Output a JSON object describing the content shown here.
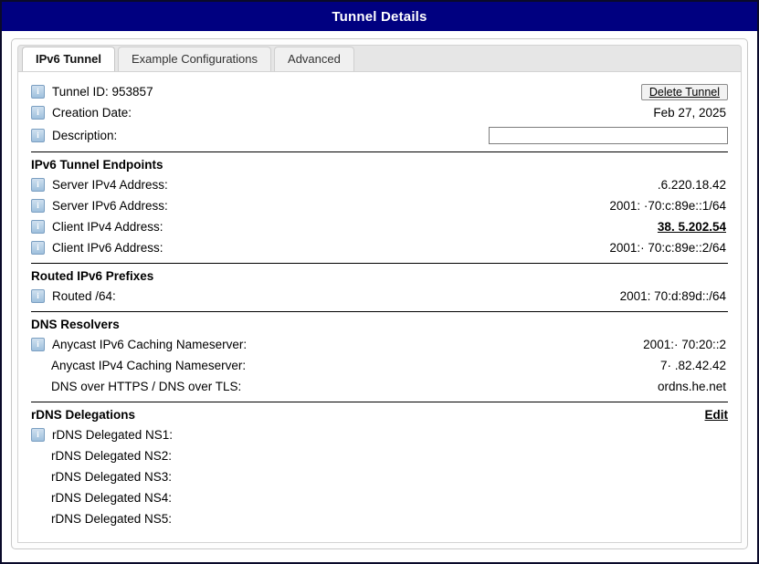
{
  "window": {
    "title": "Tunnel Details"
  },
  "tabs": [
    {
      "label": "IPv6 Tunnel",
      "active": true
    },
    {
      "label": "Example Configurations",
      "active": false
    },
    {
      "label": "Advanced",
      "active": false
    }
  ],
  "icons": {
    "info": "i",
    "info_name": "info-icon"
  },
  "top": {
    "tunnel_id_label": "Tunnel ID: 953857",
    "delete_button": "Delete Tunnel",
    "creation_date_label": "Creation Date:",
    "creation_date_value": "Feb 27, 2025",
    "description_label": "Description:",
    "description_value": "",
    "description_placeholder": ""
  },
  "endpoints": {
    "title": "IPv6 Tunnel Endpoints",
    "rows": [
      {
        "label": "Server IPv4 Address:",
        "value": ".6.220.18.42"
      },
      {
        "label": "Server IPv6 Address:",
        "value": "2001: ·70:c:89e::1/64"
      },
      {
        "label": "Client IPv4 Address:",
        "value": "38. 5.202.54"
      },
      {
        "label": "Client IPv6 Address:",
        "value": "2001:· 70:c:89e::2/64"
      }
    ]
  },
  "routed": {
    "title": "Routed IPv6 Prefixes",
    "rows": [
      {
        "label": "Routed /64:",
        "value": "2001:  70:d:89d::/64"
      }
    ]
  },
  "dns": {
    "title": "DNS Resolvers",
    "rows": [
      {
        "label": "Anycast IPv6 Caching Nameserver:",
        "value": "2001:· 70:20::2"
      },
      {
        "label": "Anycast IPv4 Caching Nameserver:",
        "value": "7· .82.42.42"
      },
      {
        "label": "DNS over HTTPS / DNS over TLS:",
        "value": "ordns.he.net"
      }
    ]
  },
  "rdns": {
    "title": "rDNS Delegations",
    "edit_label": "Edit",
    "rows": [
      {
        "label": "rDNS Delegated NS1:",
        "value": ""
      },
      {
        "label": "rDNS Delegated NS2:",
        "value": ""
      },
      {
        "label": "rDNS Delegated NS3:",
        "value": ""
      },
      {
        "label": "rDNS Delegated NS4:",
        "value": ""
      },
      {
        "label": "rDNS Delegated NS5:",
        "value": ""
      }
    ]
  },
  "colors": {
    "titlebar_bg": "#000080",
    "titlebar_text": "#ffffff",
    "page_bg": "#ffffff",
    "tab_active_bg": "#ffffff",
    "tab_inactive_bg": "#f0f0f0",
    "icon_blue": "#9fc0dd"
  }
}
